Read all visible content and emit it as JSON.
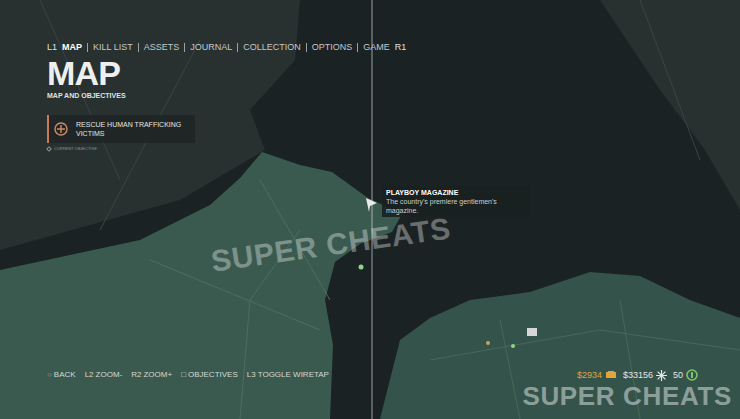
{
  "nav": {
    "left_key": "L1",
    "right_key": "R1",
    "items": [
      {
        "label": "MAP",
        "selected": true
      },
      {
        "label": "KILL LIST",
        "selected": false
      },
      {
        "label": "ASSETS",
        "selected": false
      },
      {
        "label": "JOURNAL",
        "selected": false
      },
      {
        "label": "COLLECTION",
        "selected": false
      },
      {
        "label": "OPTIONS",
        "selected": false
      },
      {
        "label": "GAME",
        "selected": false
      }
    ]
  },
  "title": "MAP",
  "subtitle": "MAP AND OBJECTIVES",
  "objective": {
    "label": "RESCUE HUMAN TRAFFICKING VICTIMS",
    "note": "CURRENT OBJECTIVE"
  },
  "tooltip": {
    "title": "PLAYBOY MAGAZINE",
    "text": "The country's premiere gentlemen's magazine."
  },
  "controls": [
    {
      "key": "○",
      "label": "BACK"
    },
    {
      "key": "L2",
      "label": "ZOOM-"
    },
    {
      "key": "R2",
      "label": "ZOOM+"
    },
    {
      "key": "□",
      "label": "OBJECTIVES"
    },
    {
      "key": "L3",
      "label": "TOGGLE WIRETAP"
    }
  ],
  "stats": [
    {
      "value": "$2934",
      "color": "#e0a43a"
    },
    {
      "value": "$33156",
      "color": "#e6e6e6"
    },
    {
      "value": "50",
      "color": "#e6e6e6"
    }
  ],
  "watermarks": [
    "SUPER CHEATS",
    "SUPER CHEATS"
  ]
}
